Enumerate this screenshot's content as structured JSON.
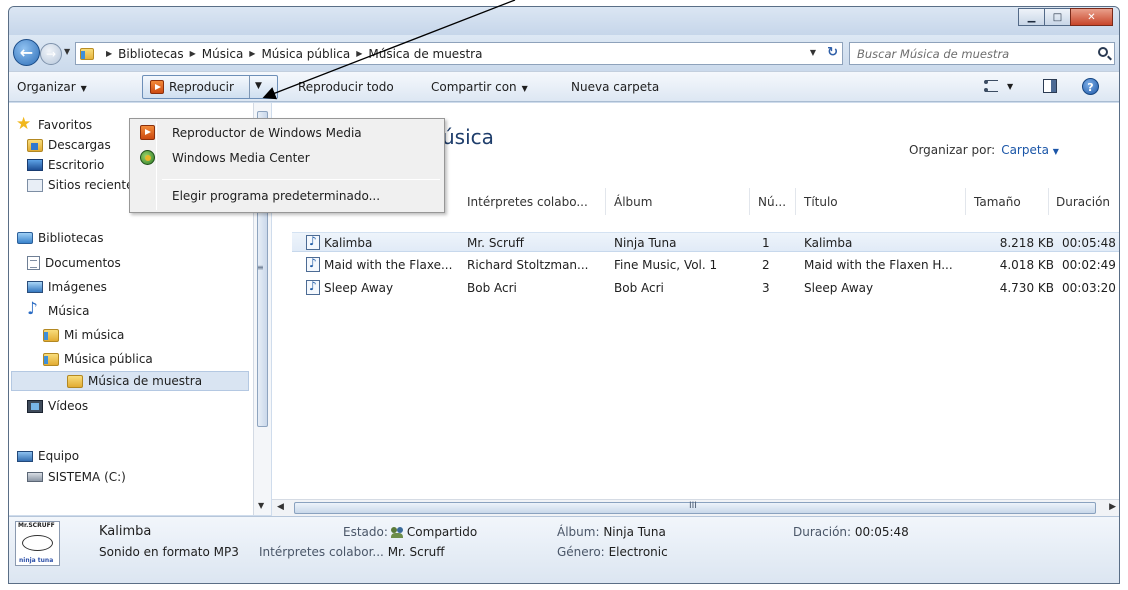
{
  "window": {
    "minimize_icon": "minimize-icon",
    "maximize_icon": "maximize-icon",
    "close_icon": "close-icon"
  },
  "address": {
    "crumbs": [
      "Bibliotecas",
      "Música",
      "Música pública",
      "Música de muestra"
    ],
    "search_placeholder": "Buscar Música de muestra"
  },
  "toolbar": {
    "organize": "Organizar",
    "play": "Reproducir",
    "play_all": "Reproducir todo",
    "share_with": "Compartir con",
    "new_folder": "Nueva carpeta"
  },
  "play_menu": {
    "items": [
      {
        "label": "Reproductor de Windows Media",
        "icon": "windows-media-player-icon"
      },
      {
        "label": "Windows Media Center",
        "icon": "windows-media-center-icon"
      },
      {
        "label": "Elegir programa predeterminado...",
        "icon": ""
      }
    ]
  },
  "nav": {
    "favorites": "Favoritos",
    "downloads": "Descargas",
    "desktop": "Escritorio",
    "recent": "Sitios recientes",
    "libraries": "Bibliotecas",
    "documents": "Documentos",
    "images": "Imágenes",
    "music": "Música",
    "my_music": "Mi música",
    "public_music": "Música pública",
    "sample_music": "Música de muestra",
    "videos": "Vídeos",
    "computer": "Equipo",
    "system_drive": "SISTEMA (C:)"
  },
  "content": {
    "library_title": "úsica",
    "arrange_by_label": "Organizar por:",
    "arrange_by_value": "Carpeta",
    "columns": [
      "Intérpretes colabo...",
      "Álbum",
      "Nú...",
      "Título",
      "Tamaño",
      "Duración"
    ],
    "rows": [
      {
        "name": "Kalimba",
        "artists": "Mr. Scruff",
        "album": "Ninja Tuna",
        "num": "1",
        "title": "Kalimba",
        "size": "8.218 KB",
        "duration": "00:05:48"
      },
      {
        "name": "Maid with the Flaxe...",
        "artists": "Richard Stoltzman...",
        "album": "Fine Music, Vol. 1",
        "num": "2",
        "title": "Maid with the Flaxen H...",
        "size": "4.018 KB",
        "duration": "00:02:49"
      },
      {
        "name": "Sleep Away",
        "artists": "Bob Acri",
        "album": "Bob Acri",
        "num": "3",
        "title": "Sleep Away",
        "size": "4.730 KB",
        "duration": "00:03:20"
      }
    ]
  },
  "details": {
    "thumb_top": "Mr.SCRUFF",
    "thumb_bottom": "ninja tuna",
    "name": "Kalimba",
    "type": "Sonido en formato MP3",
    "state_label": "Estado:",
    "state_value": "Compartido",
    "artists_label": "Intérpretes colabor...",
    "artists_value": "Mr. Scruff",
    "album_label": "Álbum:",
    "album_value": "Ninja Tuna",
    "genre_label": "Género:",
    "genre_value": "Electronic",
    "duration_label": "Duración:",
    "duration_value": "00:05:48"
  },
  "scroll": {
    "grip": "III"
  }
}
